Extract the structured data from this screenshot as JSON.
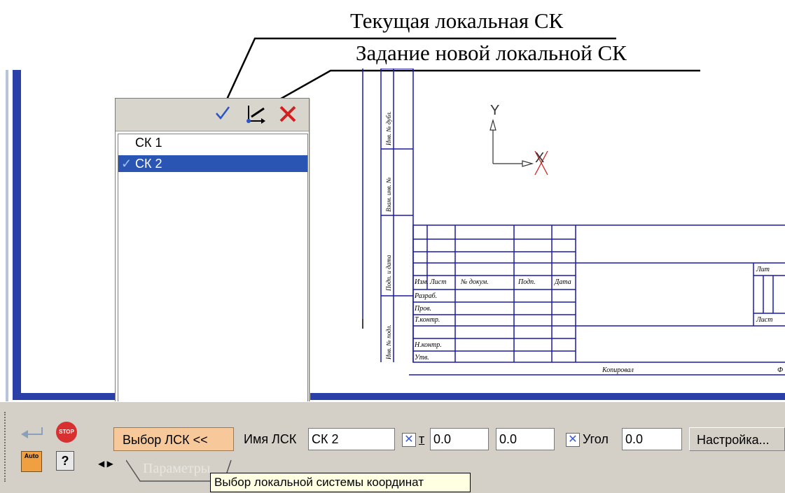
{
  "callouts": {
    "current_lcs": "Текущая локальная СК",
    "new_lcs": "Задание новой локальной СК"
  },
  "lcs_panel": {
    "items": [
      {
        "label": "СК 1",
        "selected": false
      },
      {
        "label": "СК 2",
        "selected": true
      }
    ]
  },
  "toolbar": {
    "select_lcs_button": "Выбор ЛСК  <<",
    "name_label": "Имя ЛСК",
    "name_value": "СК 2",
    "t_label": "т",
    "x_value": "0.0",
    "y_value": "0.0",
    "angle_label": "Угол",
    "angle_value": "0.0",
    "settings_button": "Настройка...",
    "auto_label": "Auto",
    "help_label": "?",
    "stop_label": "STOP",
    "tab_label": "Параметры"
  },
  "tooltip": "Выбор локальной системы координат",
  "drawing": {
    "axis_y": "Y",
    "axis_x": "X",
    "table_headers": [
      "Изм.",
      "Лист",
      "№ докум.",
      "Подп.",
      "Дата"
    ],
    "row_labels": [
      "Разраб.",
      "Пров.",
      "Т.контр.",
      "Н.контр.",
      "Утв."
    ],
    "side_labels": [
      "Инв. № дубл.",
      "Взам. инв. №",
      "Подп. и дата",
      "Инв. № подл."
    ],
    "lit_label": "Лит",
    "list_label": "Лист",
    "copied_label": "Копировал",
    "format_label": "Ф"
  },
  "colors": {
    "frame_blue": "#2a3fa8",
    "selection_blue": "#2b55b3",
    "drawing_line": "#1a1aa8",
    "toolbar_bg": "#d4d0c8",
    "select_button_bg": "#f7c99a",
    "tooltip_bg": "#ffffe1",
    "close_red": "#d02020"
  }
}
